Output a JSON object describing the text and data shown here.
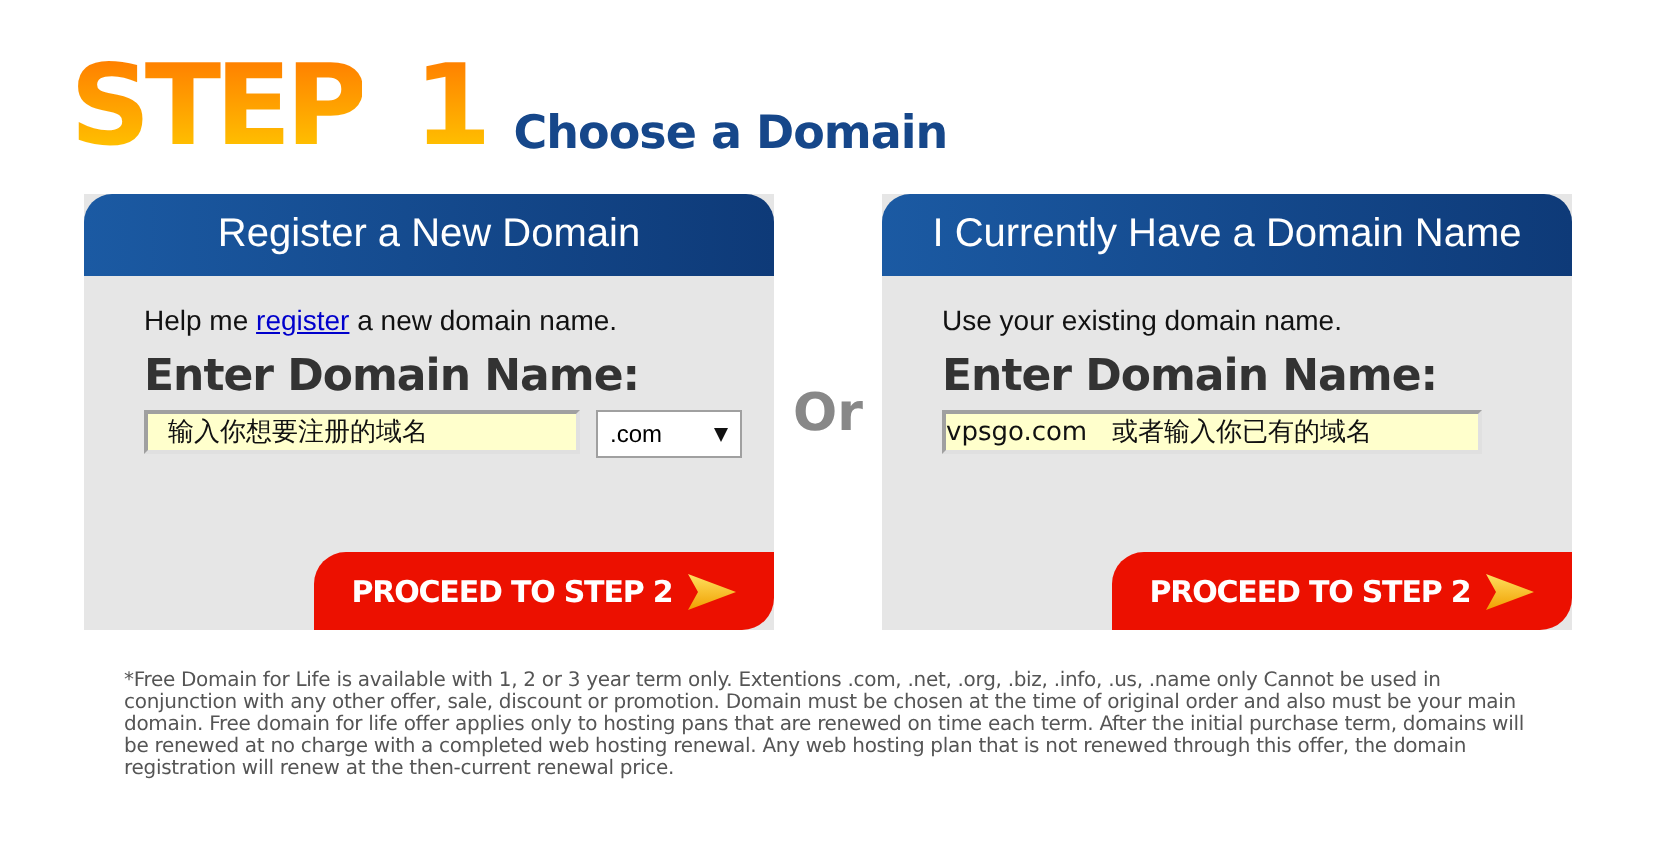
{
  "header": {
    "step_label": "STEP",
    "step_number": "1",
    "title": "Choose a Domain"
  },
  "panels": [
    {
      "kind": "register",
      "title": "Register a New Domain",
      "intro": {
        "before": "Help me ",
        "link": "register",
        "after": " a new domain name."
      },
      "heading": "Enter Domain Name:",
      "input_value": "输入你想要注册的域名",
      "extension": ".com",
      "button": "PROCEED TO STEP 2"
    },
    {
      "kind": "existing",
      "title": "I Currently Have a Domain Name",
      "intro": {
        "before": "Use your existing domain name."
      },
      "heading": "Enter Domain Name:",
      "input_value": "vpsgo.com   或者输入你已有的域名",
      "button": "PROCEED TO STEP 2"
    }
  ],
  "separator": "Or",
  "footnote": "*Free Domain for Life is available with 1, 2 or 3 year term only. Extentions .com, .net, .org, .biz, .info, .us, .name only Cannot be used in conjunction with any other offer, sale, discount or promotion. Domain must be chosen at the time of original order and also must be your main domain. Free domain for life offer applies only to hosting pans that are renewed on time each term. After the initial purchase term, domains will be renewed at no charge with a completed web hosting renewal. Any web hosting plan that is not renewed through this offer, the domain registration will renew at the then-current renewal price."
}
